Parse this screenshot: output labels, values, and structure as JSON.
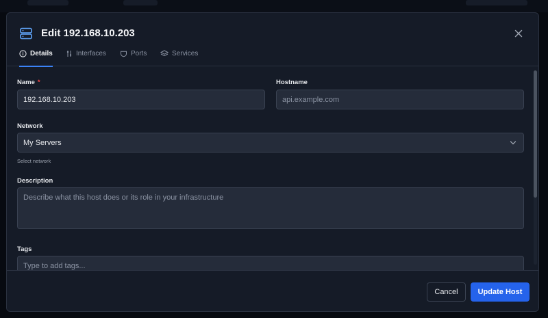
{
  "dialog": {
    "title": "Edit 192.168.10.203",
    "close_icon": "close-icon",
    "title_icon": "server-icon"
  },
  "tabs": [
    {
      "label": "Details",
      "icon": "info-icon",
      "active": true
    },
    {
      "label": "Interfaces",
      "icon": "interfaces-icon",
      "active": false
    },
    {
      "label": "Ports",
      "icon": "shield-icon",
      "active": false
    },
    {
      "label": "Services",
      "icon": "layers-icon",
      "active": false
    }
  ],
  "form": {
    "name": {
      "label": "Name",
      "required_mark": "*",
      "value": "192.168.10.203"
    },
    "hostname": {
      "label": "Hostname",
      "value": "",
      "placeholder": "api.example.com"
    },
    "network": {
      "label": "Network",
      "selected": "My Servers",
      "hint": "Select network"
    },
    "description": {
      "label": "Description",
      "value": "",
      "placeholder": "Describe what this host does or its role in your infrastructure"
    },
    "tags": {
      "label": "Tags",
      "value": "",
      "placeholder": "Type to add tags..."
    }
  },
  "footer": {
    "cancel_label": "Cancel",
    "submit_label": "Update Host"
  },
  "colors": {
    "accent": "#2563eb",
    "active_tab_underline": "#3b82f6",
    "required": "#ef4444",
    "modal_bg": "#151b27"
  }
}
